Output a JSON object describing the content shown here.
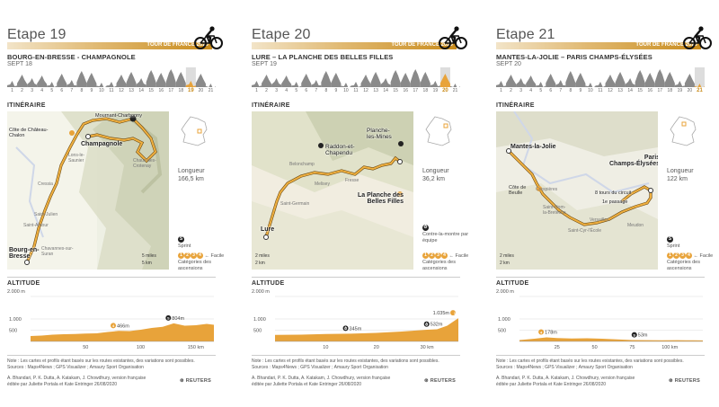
{
  "colors": {
    "accent": "#c98c1c",
    "route": "#e8a33a",
    "profile": "#e8a33a",
    "mini_profile": "#888888"
  },
  "brand": "TOUR DE FRANCE 2020",
  "mini_stage_numbers": [
    "1",
    "2",
    "3",
    "4",
    "5",
    "6",
    "7",
    "8",
    "9",
    "10",
    "11",
    "12",
    "13",
    "14",
    "15",
    "16",
    "17",
    "18",
    "19",
    "20",
    "21"
  ],
  "mini_profile_heights": [
    0.35,
    0.7,
    0.5,
    0.65,
    0.3,
    0.75,
    0.4,
    0.9,
    0.8,
    0.25,
    0.3,
    0.7,
    0.85,
    0.5,
    0.95,
    0.8,
    1.0,
    0.85,
    0.35,
    0.75,
    0.2
  ],
  "legend": {
    "sprint": "Sprint",
    "time_trial": "Contre-la-montre par équipe",
    "cat_line1": "← Facile",
    "cat_line2": "Catégories des",
    "cat_line3": "ascensions"
  },
  "stages": [
    {
      "title": "Etape 19",
      "route": "BOURG-EN-BRESSE - CHAMPAGNOLE",
      "date": "SEPT 18",
      "number": 19,
      "itinerary_label": "ITINÉRAIRE",
      "length_label": "Longueur",
      "length_value": "166,5 km",
      "altitude_label": "ALTITUDE",
      "alt_top": "2.000 m",
      "alt_1000": "1.000",
      "alt_500": "500",
      "x_ticks": [
        "50",
        "100",
        "150 km"
      ],
      "annotations": [
        "466m",
        "804m"
      ],
      "scale_miles": "5 miles",
      "scale_km": "5 km",
      "map_labels": {
        "start": "Bourg-en-\nBresse",
        "finish": "Champagnole",
        "chalon": "Côte de Château-\nChalon",
        "mourant": "Mournant-Charbonny",
        "lons": "Lons-le-\nSaunier",
        "chaux": "Chaux-des-\nCrotenay",
        "st_amour": "Saint-Amour",
        "cressia": "Cressia",
        "st_julien": "Saint-Julien",
        "chavannes": "Chavannes-sur-\nSuran"
      },
      "note": "Note : Les cartes et profils étant basés sur les routes existantes, des variations sont possibles.",
      "sources": "Sources : Maps4News ; GPS Visualizer ; Amaury Sport Organisation",
      "credits": "A. Bhandari, P. K. Dutta, A. Katakam, J. Chowdhury, version française éditée par Juliette Portala et Kate Entringer 26/08/2020",
      "reuters": "REUTERS"
    },
    {
      "title": "Etape 20",
      "route": "LURE – LA PLANCHE DES BELLES FILLES",
      "date": "SEPT 19",
      "number": 20,
      "itinerary_label": "ITINÉRAIRE",
      "length_label": "Longueur",
      "length_value": "36,2 km",
      "altitude_label": "ALTITUDE",
      "alt_top": "2.000 m",
      "alt_1000": "1.000",
      "alt_500": "500",
      "x_ticks": [
        "10",
        "20",
        "30 km"
      ],
      "annotations": [
        "345m",
        "532m",
        "1.035m"
      ],
      "scale_miles": "2 miles",
      "scale_km": "2 km",
      "map_labels": {
        "start": "Lure",
        "finish": "La Planche des\nBelles Filles",
        "raddon": "Raddon-et-\nChapendu",
        "planche_mines": "Planche-\nles-Mines",
        "belonchamp": "Belonchamp",
        "melisey": "Melisey",
        "fresse": "Fresse",
        "st_germain": "Saint-Germain"
      },
      "note": "Note : Les cartes et profils étant basés sur les routes existantes, des variations sont possibles.",
      "sources": "Sources : Maps4News ; GPS Visualizer ; Amaury Sport Organisation",
      "credits": "A. Bhandari, P. K. Dutta, A. Katakam, J. Chowdhury, version française éditée par Juliette Portala et Kate Entringer 26/08/2020",
      "reuters": "REUTERS"
    },
    {
      "title": "Etape 21",
      "route": "MANTES-LA-JOLIE – PARIS CHAMPS-ÉLYSÉES",
      "date": "SEPT 20",
      "number": 21,
      "itinerary_label": "ITINÉRAIRE",
      "length_label": "Longueur",
      "length_value": "122 km",
      "altitude_label": "ALTITUDE",
      "alt_top": "2.000 m",
      "alt_1000": "1.000",
      "alt_500": "500",
      "x_ticks": [
        "25",
        "50",
        "75",
        "100 km"
      ],
      "annotations": [
        "178m",
        "53m"
      ],
      "scale_miles": "2 miles",
      "scale_km": "2 km",
      "map_labels": {
        "start": "Mantes-la-Jolie",
        "finish": "Paris\nChamps-Élysées",
        "beulle": "Côte de\nBeulle",
        "tours": "8 tours du circuit",
        "passage": "1e passage",
        "crespieres": "Crespières",
        "st_nom": "Saint-Nom-\nla-Bretèche",
        "versailles": "Versailles",
        "st_cyr": "Saint-Cyr-l'École",
        "meudon": "Meudon"
      },
      "note": "Note : Les cartes et profils étant basés sur les routes existantes, des variations sont possibles.",
      "sources": "Sources : Maps4News ; GPS Visualizer ; Amaury Sport Organisation",
      "credits": "A. Bhandari, P. K. Dutta, A. Katakam, J. Chowdhury, version française éditée par Juliette Portala et Kate Entringer 26/08/2020",
      "reuters": "REUTERS"
    }
  ]
}
